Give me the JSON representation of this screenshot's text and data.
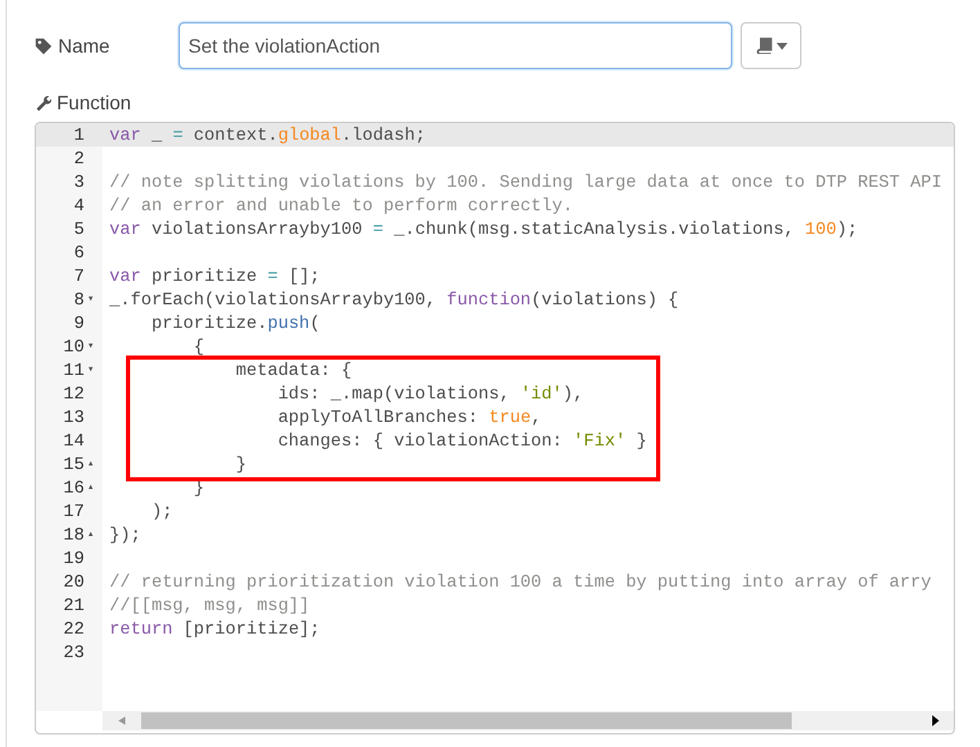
{
  "name_field": {
    "label": "Name",
    "value": "Set the violationAction"
  },
  "function_label": "Function",
  "editor": {
    "lines": [
      {
        "number": "1",
        "active": true,
        "highlighted": false,
        "tokens": [
          {
            "t": "var",
            "kind": "keyword"
          },
          {
            "t": " _ ",
            "kind": "plain"
          },
          {
            "t": "=",
            "kind": "operator"
          },
          {
            "t": " context.",
            "kind": "plain"
          },
          {
            "t": "global",
            "kind": "atom"
          },
          {
            "t": ".lodash;",
            "kind": "plain"
          }
        ]
      },
      {
        "number": "2",
        "active": false,
        "highlighted": false
      },
      {
        "number": "3",
        "active": false,
        "highlighted": false,
        "tokens": [
          {
            "t": "// note splitting violations by 100. Sending large data at once to DTP REST API",
            "kind": "comment"
          }
        ]
      },
      {
        "number": "4",
        "active": false,
        "highlighted": false,
        "tokens": [
          {
            "t": "// an error and unable to perform correctly.",
            "kind": "comment"
          }
        ]
      },
      {
        "number": "5",
        "active": false,
        "highlighted": false,
        "tokens": [
          {
            "t": "var",
            "kind": "keyword"
          },
          {
            "t": " violationsArrayby100 ",
            "kind": "plain"
          },
          {
            "t": "=",
            "kind": "operator"
          },
          {
            "t": " _.chunk(msg.staticAnalysis.violations, ",
            "kind": "plain"
          },
          {
            "t": "100",
            "kind": "atom"
          },
          {
            "t": ");",
            "kind": "plain"
          }
        ]
      },
      {
        "number": "6",
        "active": false,
        "highlighted": false
      },
      {
        "number": "7",
        "active": false,
        "highlighted": false,
        "tokens": [
          {
            "t": "var",
            "kind": "keyword"
          },
          {
            "t": " prioritize ",
            "kind": "plain"
          },
          {
            "t": "=",
            "kind": "operator"
          },
          {
            "t": " [];",
            "kind": "plain"
          }
        ]
      },
      {
        "number": "8",
        "fold": "▾",
        "active": false,
        "highlighted": false,
        "tokens": [
          {
            "t": "_.forEach(violationsArrayby100, ",
            "kind": "plain"
          },
          {
            "t": "function",
            "kind": "keyword"
          },
          {
            "t": "(violations) {",
            "kind": "plain"
          }
        ]
      },
      {
        "number": "9",
        "active": false,
        "highlighted": false,
        "tokens": [
          {
            "t": "    prioritize.",
            "kind": "plain"
          },
          {
            "t": "push",
            "kind": "property"
          },
          {
            "t": "(",
            "kind": "plain"
          }
        ]
      },
      {
        "number": "10",
        "fold": "▾",
        "active": false,
        "highlighted": false,
        "tokens": [
          {
            "t": "        {",
            "kind": "plain"
          }
        ]
      },
      {
        "number": "11",
        "fold": "▾",
        "active": false,
        "highlighted": true,
        "tokens": [
          {
            "t": "            metadata: {",
            "kind": "plain"
          }
        ]
      },
      {
        "number": "12",
        "active": false,
        "highlighted": true,
        "tokens": [
          {
            "t": "                ids: _.map(violations, ",
            "kind": "plain"
          },
          {
            "t": "'id'",
            "kind": "string"
          },
          {
            "t": "),",
            "kind": "plain"
          }
        ]
      },
      {
        "number": "13",
        "active": false,
        "highlighted": true,
        "tokens": [
          {
            "t": "                applyToAllBranches: ",
            "kind": "plain"
          },
          {
            "t": "true",
            "kind": "atom"
          },
          {
            "t": ",",
            "kind": "plain"
          }
        ]
      },
      {
        "number": "14",
        "active": false,
        "highlighted": true,
        "tokens": [
          {
            "t": "                changes: { violationAction: ",
            "kind": "plain"
          },
          {
            "t": "'Fix'",
            "kind": "string"
          },
          {
            "t": " }",
            "kind": "plain"
          }
        ]
      },
      {
        "number": "15",
        "fold": "▴",
        "active": false,
        "highlighted": true,
        "tokens": [
          {
            "t": "            }",
            "kind": "plain"
          }
        ]
      },
      {
        "number": "16",
        "fold": "▴",
        "active": false,
        "highlighted": false,
        "tokens": [
          {
            "t": "        }",
            "kind": "plain"
          }
        ]
      },
      {
        "number": "17",
        "active": false,
        "highlighted": false,
        "tokens": [
          {
            "t": "    );",
            "kind": "plain"
          }
        ]
      },
      {
        "number": "18",
        "fold": "▴",
        "active": false,
        "highlighted": false,
        "tokens": [
          {
            "t": "});",
            "kind": "plain"
          }
        ]
      },
      {
        "number": "19",
        "active": false,
        "highlighted": false
      },
      {
        "number": "20",
        "active": false,
        "highlighted": false,
        "tokens": [
          {
            "t": "// returning prioritization violation 100 a time by putting into array of arry",
            "kind": "comment"
          }
        ]
      },
      {
        "number": "21",
        "active": false,
        "highlighted": false,
        "tokens": [
          {
            "t": "//[[msg, msg, msg]]",
            "kind": "comment"
          }
        ]
      },
      {
        "number": "22",
        "active": false,
        "highlighted": false,
        "tokens": [
          {
            "t": "return",
            "kind": "keyword"
          },
          {
            "t": " [prioritize];",
            "kind": "plain"
          }
        ]
      },
      {
        "number": "23",
        "active": false,
        "highlighted": false
      }
    ]
  }
}
